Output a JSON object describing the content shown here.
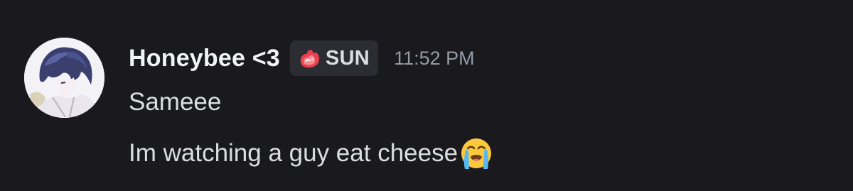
{
  "message": {
    "author": "Honeybee <3",
    "role_tag": {
      "label": "SUN",
      "icon": "red-flame-icon",
      "color": "#e8424f"
    },
    "timestamp": "11:52 PM",
    "lines": [
      {
        "text": "Sameee"
      },
      {
        "text": "Im watching a guy eat cheese",
        "emoji": "loudly-crying-face-icon"
      }
    ]
  },
  "colors": {
    "background": "#1a1a1e",
    "username": "#f2f3f5",
    "message_text": "#dbdee1",
    "timestamp": "#949ba4",
    "tag_background": "#2c2d32"
  }
}
